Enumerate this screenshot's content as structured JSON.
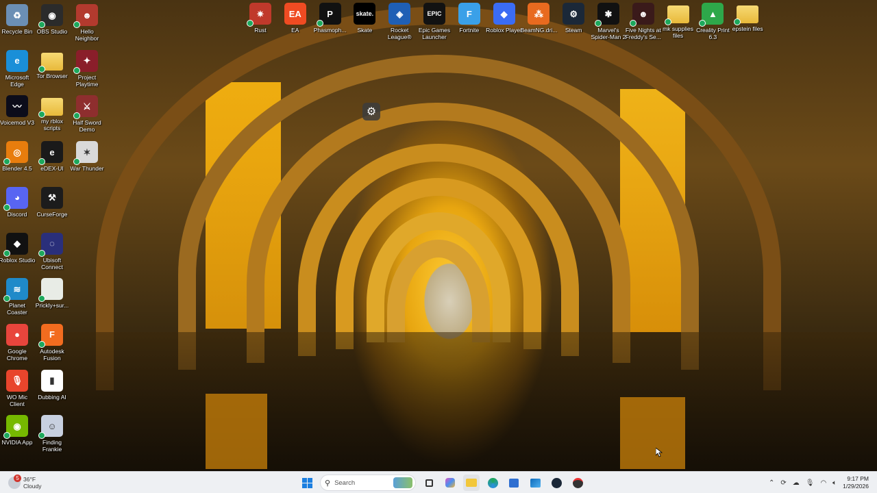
{
  "desktop": {
    "left_icons": [
      {
        "name": "recycle-bin",
        "label": "Recycle Bin",
        "icon": "recycle-bin-icon",
        "color": "#6b8fb5",
        "glyph": "♻",
        "col": 0,
        "row": 0,
        "badge": false
      },
      {
        "name": "obs-studio",
        "label": "OBS Studio",
        "icon": "obs-icon",
        "color": "#2b2b2b",
        "glyph": "◉",
        "col": 1,
        "row": 0,
        "badge": true
      },
      {
        "name": "hello-neighbor",
        "label": "Hello Neighbor",
        "icon": "hello-neighbor-icon",
        "color": "#b33a2e",
        "glyph": "☻",
        "col": 2,
        "row": 0,
        "badge": true
      },
      {
        "name": "microsoft-edge",
        "label": "Microsoft Edge",
        "icon": "edge-icon",
        "color": "#1a8fd8",
        "glyph": "e",
        "col": 0,
        "row": 1,
        "badge": false
      },
      {
        "name": "tor-browser",
        "label": "Tor Browser",
        "icon": "folder-icon",
        "color": "#e8c34a",
        "glyph": "",
        "col": 1,
        "row": 1,
        "badge": true
      },
      {
        "name": "project-playtime",
        "label": "Project Playtime",
        "icon": "project-playtime-icon",
        "color": "#8a1e2a",
        "glyph": "✦",
        "col": 2,
        "row": 1,
        "badge": true
      },
      {
        "name": "voicemod",
        "label": "Voicemod V3",
        "icon": "voicemod-icon",
        "color": "#0c0c1a",
        "glyph": "〰",
        "col": 0,
        "row": 2,
        "badge": false
      },
      {
        "name": "my-rblox-scripts",
        "label": "my rblox scripts",
        "icon": "folder-icon",
        "color": "#f2cf5b",
        "glyph": "",
        "col": 1,
        "row": 2,
        "badge": true
      },
      {
        "name": "half-sword-demo",
        "label": "Half Sword Demo",
        "icon": "half-sword-icon",
        "color": "#8e2e2e",
        "glyph": "⚔",
        "col": 2,
        "row": 2,
        "badge": true
      },
      {
        "name": "blender",
        "label": "Blender 4.5",
        "icon": "blender-icon",
        "color": "#e87d0d",
        "glyph": "◎",
        "col": 0,
        "row": 3,
        "badge": true
      },
      {
        "name": "edex-ui",
        "label": "eDEX-UI",
        "icon": "edex-icon",
        "color": "#1a1a1a",
        "glyph": "e",
        "col": 1,
        "row": 3,
        "badge": true
      },
      {
        "name": "war-thunder",
        "label": "War Thunder",
        "icon": "war-thunder-icon",
        "color": "#d9d9d9",
        "glyph": "✶",
        "col": 2,
        "row": 3,
        "badge": true
      },
      {
        "name": "discord",
        "label": "Discord",
        "icon": "discord-icon",
        "color": "#5865f2",
        "glyph": "◕",
        "col": 0,
        "row": 4,
        "badge": true
      },
      {
        "name": "curseforge",
        "label": "CurseForge",
        "icon": "curseforge-icon",
        "color": "#1c1c1c",
        "glyph": "⚒",
        "col": 1,
        "row": 4,
        "badge": false
      },
      {
        "name": "roblox-studio",
        "label": "Roblox Studio",
        "icon": "roblox-studio-icon",
        "color": "#111111",
        "glyph": "◆",
        "col": 0,
        "row": 5,
        "badge": true
      },
      {
        "name": "ubisoft-connect",
        "label": "Ubisoft Connect",
        "icon": "ubisoft-icon",
        "color": "#2a2f7a",
        "glyph": "◌",
        "col": 1,
        "row": 5,
        "badge": true
      },
      {
        "name": "planet-coaster",
        "label": "Planet Coaster",
        "icon": "planet-coaster-icon",
        "color": "#1f8ac9",
        "glyph": "≋",
        "col": 0,
        "row": 6,
        "badge": true
      },
      {
        "name": "prickly-sur",
        "label": "Prickly+sur...",
        "icon": "image-file-icon",
        "color": "#e8ece6",
        "glyph": "",
        "col": 1,
        "row": 6,
        "badge": true
      },
      {
        "name": "google-chrome",
        "label": "Google Chrome",
        "icon": "chrome-icon",
        "color": "#e8453c",
        "glyph": "●",
        "col": 0,
        "row": 7,
        "badge": false
      },
      {
        "name": "autodesk-fusion",
        "label": "Autodesk Fusion",
        "icon": "fusion-icon",
        "color": "#f26c1f",
        "glyph": "F",
        "col": 1,
        "row": 7,
        "badge": true
      },
      {
        "name": "wo-mic-client",
        "label": "WO Mic Client",
        "icon": "microphone-icon",
        "color": "#e8452c",
        "glyph": "🎙",
        "col": 0,
        "row": 8,
        "badge": false
      },
      {
        "name": "dubbing-ai",
        "label": "Dubbing AI",
        "icon": "dubbing-ai-icon",
        "color": "#ffffff",
        "glyph": "▮",
        "col": 1,
        "row": 8,
        "badge": false
      },
      {
        "name": "nvidia-app",
        "label": "NVIDIA App",
        "icon": "nvidia-icon",
        "color": "#76b900",
        "glyph": "◉",
        "col": 0,
        "row": 9,
        "badge": true
      },
      {
        "name": "finding-frankie",
        "label": "Finding Frankie",
        "icon": "finding-frankie-icon",
        "color": "#c8d0e0",
        "glyph": "☺",
        "col": 1,
        "row": 9,
        "badge": true
      }
    ],
    "top_icons": [
      {
        "name": "rust",
        "label": "Rust",
        "icon": "rust-icon",
        "color": "#c0392b",
        "glyph": "✷",
        "badge": true
      },
      {
        "name": "ea",
        "label": "EA",
        "icon": "ea-icon",
        "color": "#ef4b22",
        "glyph": "EA",
        "badge": false
      },
      {
        "name": "phasmophobia",
        "label": "Phasmoph...",
        "icon": "phasmophobia-icon",
        "color": "#111111",
        "glyph": "P",
        "badge": true
      },
      {
        "name": "skate",
        "label": "Skate",
        "icon": "skate-icon",
        "color": "#000000",
        "glyph": "skate.",
        "badge": false
      },
      {
        "name": "rocket-league",
        "label": "Rocket League®",
        "icon": "rocket-league-icon",
        "color": "#1f5fb5",
        "glyph": "◈",
        "badge": false
      },
      {
        "name": "epic-games",
        "label": "Epic Games Launcher",
        "icon": "epic-games-icon",
        "color": "#121212",
        "glyph": "EPIC",
        "badge": false
      },
      {
        "name": "fortnite",
        "label": "Fortnite",
        "icon": "fortnite-icon",
        "color": "#3aa0e8",
        "glyph": "F",
        "badge": false
      },
      {
        "name": "roblox-player",
        "label": "Roblox Player",
        "icon": "roblox-icon",
        "color": "#3b6cf4",
        "glyph": "◆",
        "badge": false
      },
      {
        "name": "beamng",
        "label": "BeamNG.dri...",
        "icon": "beamng-icon",
        "color": "#e86a1f",
        "glyph": "⁂",
        "badge": false
      },
      {
        "name": "steam",
        "label": "Steam",
        "icon": "steam-icon",
        "color": "#1b2838",
        "glyph": "⚙",
        "badge": false
      },
      {
        "name": "spider-man-2",
        "label": "Marvel's Spider-Man 2",
        "icon": "spider-man-icon",
        "color": "#111111",
        "glyph": "✱",
        "badge": true
      },
      {
        "name": "fnaf-security-breach",
        "label": "Five Nights at Freddy's Se...",
        "icon": "fnaf-icon",
        "color": "#3a1a1a",
        "glyph": "☻",
        "badge": true
      },
      {
        "name": "mk-supplies-files",
        "label": "mk supplies files",
        "icon": "folder-icon",
        "color": "#f2cf5b",
        "glyph": "",
        "badge": true
      },
      {
        "name": "creality-print",
        "label": "Creality Print 6.3",
        "icon": "creality-icon",
        "color": "#2ea84a",
        "glyph": "▲",
        "badge": true
      },
      {
        "name": "epstein-files",
        "label": "epstein files",
        "icon": "folder-icon",
        "color": "#f2cf5b",
        "glyph": "",
        "badge": true
      }
    ]
  },
  "taskbar": {
    "weather": {
      "temp": "36°F",
      "condition": "Cloudy",
      "badge_count": "5"
    },
    "search_placeholder": "Search",
    "clock": {
      "time": "9:17 PM",
      "date": "1/29/2026"
    }
  }
}
